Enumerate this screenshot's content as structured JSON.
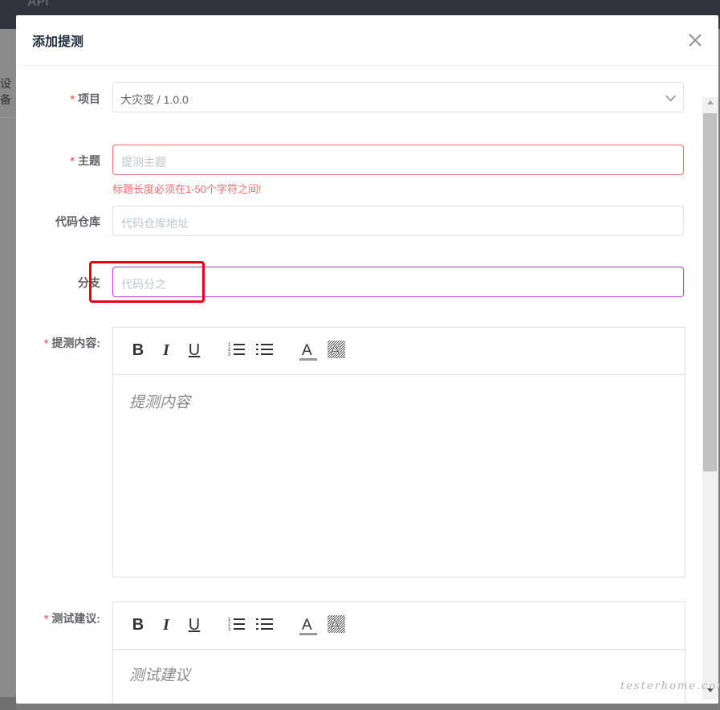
{
  "background": {
    "app_name": "API",
    "side_text": "设备"
  },
  "dialog": {
    "title": "添加提测"
  },
  "form": {
    "project": {
      "label": "项目",
      "value": "大灾变 / 1.0.0"
    },
    "subject": {
      "label": "主题",
      "placeholder": "提测主题",
      "error": "标题长度必须在1-50个字符之间!"
    },
    "repo": {
      "label": "代码仓库",
      "placeholder": "代码仓库地址"
    },
    "branch": {
      "label": "分支",
      "placeholder": "代码分之"
    },
    "content": {
      "label": "提测内容:",
      "placeholder": "提测内容"
    },
    "suggestion": {
      "label": "测试建议:",
      "placeholder": "测试建议"
    }
  },
  "toolbar": {
    "bold": "B",
    "italic": "I",
    "underline": "U",
    "font_color": "A",
    "bg_color": "A"
  },
  "required_mark": "*",
  "watermark": "testerhome.com",
  "colors": {
    "required": "#f56c6c",
    "highlight": "#e60012",
    "focus_border": "#b14fcf"
  }
}
